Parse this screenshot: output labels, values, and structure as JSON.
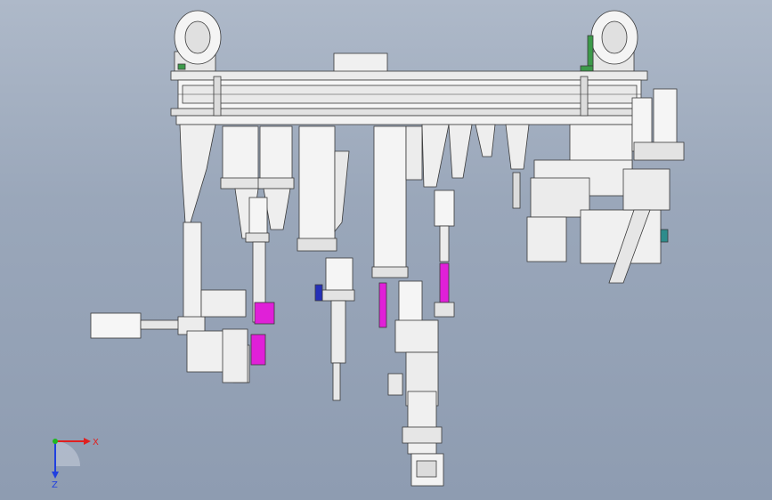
{
  "viewport": {
    "background_top": "#aeb9c9",
    "background_bottom": "#8e9cb1"
  },
  "model": {
    "part_fill": "#f2f2f2",
    "part_shade": "#d9d9d9",
    "edge_color": "#3a3a3a",
    "accent_magenta": "#e020d8",
    "accent_green": "#3c9a4a",
    "accent_blue": "#2530b8",
    "accent_teal": "#2d8c8c"
  },
  "triad": {
    "x_label": "X",
    "z_label": "Z",
    "x_color": "#e02020",
    "y_color": "#1fb81f",
    "z_color": "#2040e0"
  }
}
